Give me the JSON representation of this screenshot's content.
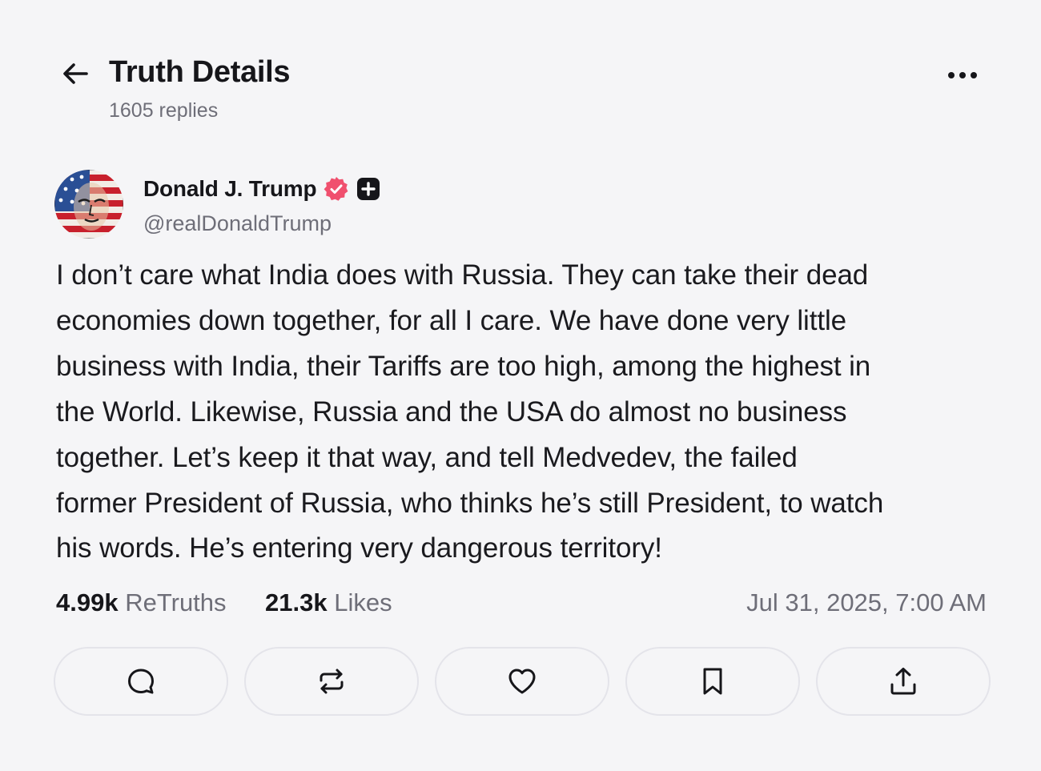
{
  "header": {
    "title": "Truth Details",
    "reply_count": "1605 replies"
  },
  "author": {
    "name": "Donald J. Trump",
    "handle": "@realDonaldTrump",
    "verified": true,
    "verified_color": "#f0506e"
  },
  "post": {
    "text_lines": [
      "I don’t care what India does with Russia. They can take their dead",
      "economies down together, for all I care. We have done very little",
      "business with India, their Tariffs are too high, among the highest in",
      "the World. Likewise, Russia and the USA do almost no business",
      "together. Let’s keep it that way, and tell Medvedev, the failed",
      "former President of Russia, who thinks he’s still President, to watch",
      "his words. He’s entering very dangerous territory!"
    ]
  },
  "stats": {
    "retruths_count": "4.99k",
    "retruths_label": "ReTruths",
    "likes_count": "21.3k",
    "likes_label": "Likes",
    "timestamp": "Jul 31, 2025, 7:00 AM"
  },
  "actions": [
    {
      "icon": "reply-icon"
    },
    {
      "icon": "retruth-icon"
    },
    {
      "icon": "like-icon"
    },
    {
      "icon": "bookmark-icon"
    },
    {
      "icon": "share-icon"
    }
  ]
}
